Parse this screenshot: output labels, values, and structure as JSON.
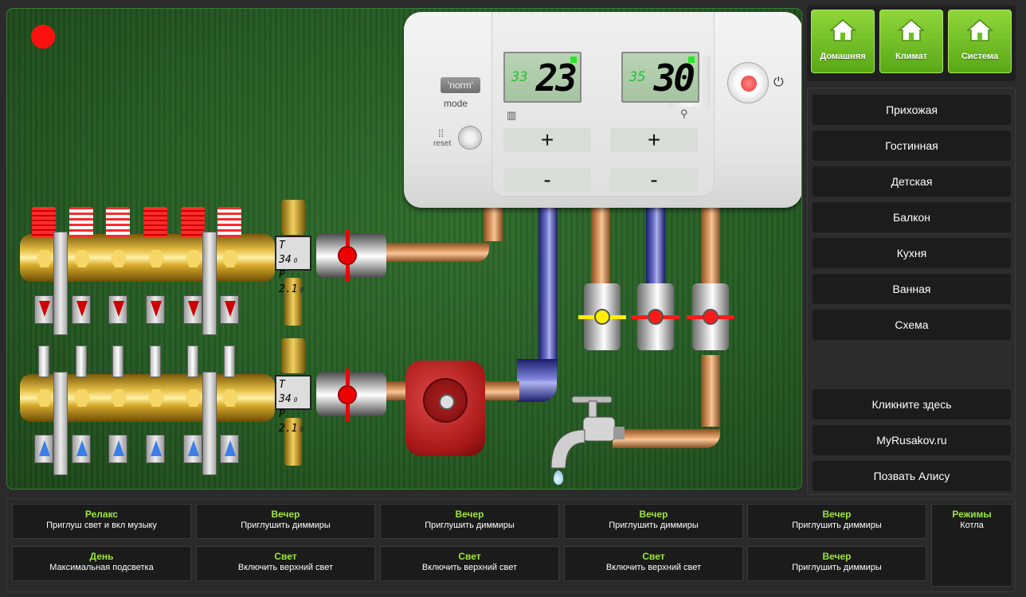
{
  "boiler": {
    "mode_button": "'norm'",
    "mode_label": "mode",
    "reset_label": "reset",
    "heating": {
      "set_small": "33",
      "current_big": "23"
    },
    "water": {
      "set_small": "35",
      "current_big": "30"
    },
    "plus": "+",
    "minus": "-"
  },
  "manifolds": {
    "supply": {
      "T": "T 34",
      "P": "P 2.1",
      "sub_t": "0",
      "sub_p": "B"
    },
    "return": {
      "T": "T 34",
      "P": "P 2.1",
      "sub_t": "0",
      "sub_p": "B"
    }
  },
  "valves": {
    "colors": [
      "#ffee00",
      "#ff1a1a",
      "#ff1a1a"
    ]
  },
  "nav": [
    {
      "label": "Домашняя",
      "icon": "house-icon"
    },
    {
      "label": "Климат",
      "icon": "house-icon"
    },
    {
      "label": "Система",
      "icon": "house-icon"
    }
  ],
  "rooms": [
    "Прихожая",
    "Гостинная",
    "Детская",
    "Балкон",
    "Кухня",
    "Ванная",
    "Схема"
  ],
  "links": [
    "Кликните здесь",
    "MyRusakov.ru",
    "Позвать Алису"
  ],
  "scenes": [
    [
      {
        "title": "Релакс",
        "subtitle": "Приглуш свет и вкл музыку"
      },
      {
        "title": "Вечер",
        "subtitle": "Приглушить диммиры"
      },
      {
        "title": "Вечер",
        "subtitle": "Приглушить диммиры"
      },
      {
        "title": "Вечер",
        "subtitle": "Приглушить диммиры"
      },
      {
        "title": "Вечер",
        "subtitle": "Приглушить диммиры"
      }
    ],
    [
      {
        "title": "День",
        "subtitle": "Максимальная подсветка"
      },
      {
        "title": "Свет",
        "subtitle": "Включить верхний свет"
      },
      {
        "title": "Свет",
        "subtitle": "Включить верхний свет"
      },
      {
        "title": "Свет",
        "subtitle": "Включить верхний свет"
      },
      {
        "title": "Вечер",
        "subtitle": "Приглушить диммиры"
      }
    ]
  ],
  "modes": {
    "title": "Режимы",
    "subtitle": "Котла"
  },
  "colors": {
    "accent_green": "#9be83a",
    "tile_green": "#6cbf22",
    "record": "#ff1010"
  }
}
